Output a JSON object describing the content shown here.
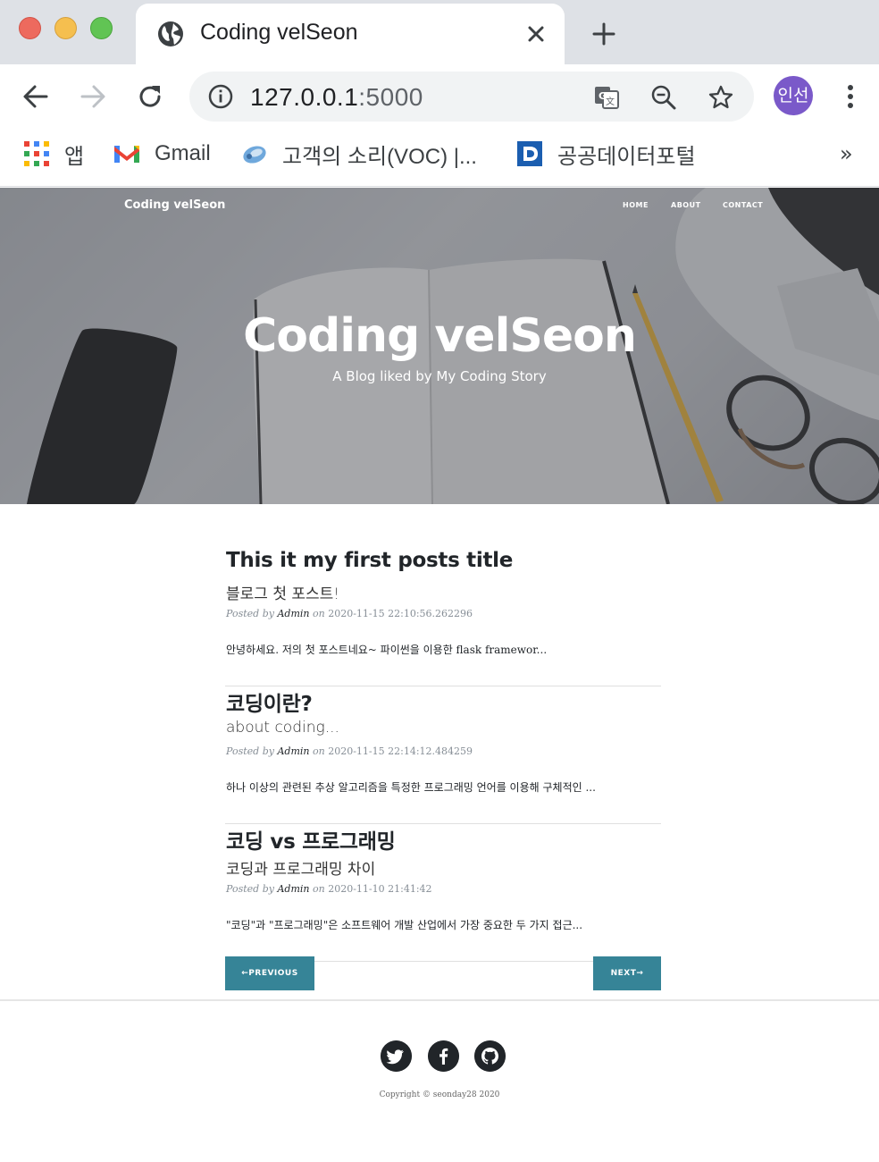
{
  "browser": {
    "tab_title": "Coding velSeon",
    "url_host": "127.0.0.1",
    "url_port": ":5000",
    "profile_label": "인선",
    "bookmarks": [
      {
        "label": "앱",
        "icon": "apps-grid-icon"
      },
      {
        "label": "Gmail",
        "icon": "gmail-icon"
      },
      {
        "label": "고객의 소리(VOC) |...",
        "icon": "voc-icon"
      },
      {
        "label": "공공데이터포털",
        "icon": "data-portal-icon"
      }
    ],
    "bookmarks_overflow": "»"
  },
  "site": {
    "brand": "Coding velSeon",
    "nav": [
      "HOME",
      "ABOUT",
      "CONTACT"
    ],
    "hero_title": "Coding velSeon",
    "hero_subtitle": "A Blog liked by My Coding Story"
  },
  "posts": [
    {
      "title": "This it my first posts title",
      "subtitle": "블로그 첫 포스트!",
      "posted_by": "Posted by",
      "author": "Admin",
      "on": "on",
      "date": "2020-11-15 22:10:56.262296",
      "excerpt": "안녕하세요. 저의 첫 포스트네요~ 파이썬을 이용한 flask framewor..."
    },
    {
      "title": "코딩이란?",
      "subtitle": "about coding...",
      "posted_by": "Posted by",
      "author": "Admin",
      "on": "on",
      "date": "2020-11-15 22:14:12.484259",
      "excerpt": "하나 이상의 관련된 추상 알고리즘을 특정한 프로그래밍 언어를 이용해 구체적인 ..."
    },
    {
      "title": "코딩 vs 프로그래밍",
      "subtitle": "코딩과 프로그래밍 차이",
      "posted_by": "Posted by",
      "author": "Admin",
      "on": "on",
      "date": "2020-11-10 21:41:42",
      "excerpt": "\"코딩\"과 \"프로그래밍\"은 소프트웨어 개발 산업에서 가장 중요한 두 가지 접근..."
    }
  ],
  "pager": {
    "previous": "←PREVIOUS",
    "next": "NEXT→"
  },
  "footer": {
    "social": [
      "twitter-icon",
      "facebook-icon",
      "github-icon"
    ],
    "copyright": "Copyright © seonday28 2020"
  },
  "colors": {
    "accent": "#368497",
    "dark": "#212529",
    "profile": "#7a59c9"
  }
}
